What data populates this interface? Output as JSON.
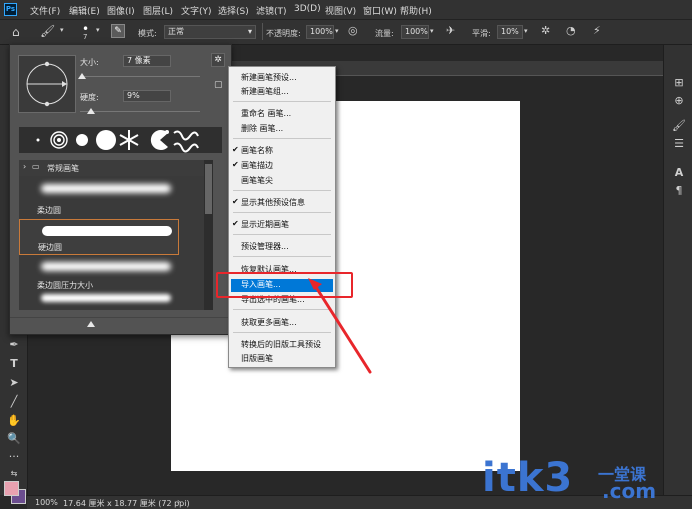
{
  "menubar": {
    "logo": "Ps",
    "items": [
      "文件(F)",
      "编辑(E)",
      "图像(I)",
      "图层(L)",
      "文字(Y)",
      "选择(S)",
      "滤镜(T)",
      "3D(D)",
      "视图(V)",
      "窗口(W)",
      "帮助(H)"
    ]
  },
  "options": {
    "size_small": "7",
    "mode_label": "模式:",
    "mode_value": "正常",
    "opacity_label": "不透明度:",
    "opacity_value": "100%",
    "flow_label": "流量:",
    "flow_value": "100%",
    "smooth_label": "平滑:",
    "smooth_value": "10%"
  },
  "brush_panel": {
    "size_label": "大小:",
    "size_value": "7 像素",
    "hardness_label": "硬度:",
    "hardness_value": "9%",
    "size_fraction": 0.02,
    "hardness_fraction": 0.09,
    "group_name": "常规画笔",
    "brushes": [
      "柔边圆",
      "硬边圆",
      "柔边圆压力大小"
    ]
  },
  "context_menu": {
    "items": [
      {
        "label": "新建画笔预设...",
        "checked": false
      },
      {
        "label": "新建画笔组...",
        "checked": false
      },
      {
        "label": "重命名 画笔...",
        "checked": false
      },
      {
        "label": "删除 画笔...",
        "checked": false
      },
      {
        "label": "画笔名称",
        "checked": true
      },
      {
        "label": "画笔描边",
        "checked": true
      },
      {
        "label": "画笔笔尖",
        "checked": false
      },
      {
        "label": "显示其他预设信息",
        "checked": true
      },
      {
        "label": "显示近期画笔",
        "checked": true
      },
      {
        "label": "预设管理器...",
        "checked": false
      },
      {
        "label": "恢复默认画笔...",
        "checked": false
      },
      {
        "label": "导入画笔...",
        "checked": false
      },
      {
        "label": "导出选中的画笔...",
        "checked": false
      },
      {
        "label": "获取更多画笔...",
        "checked": false
      },
      {
        "label": "转换后的旧版工具预设",
        "checked": false
      },
      {
        "label": "旧版画笔",
        "checked": false
      }
    ],
    "highlighted": "导入画笔..."
  },
  "status": {
    "zoom": "100%",
    "doc_info": "17.64 厘米 x 18.77 厘米 (72 ppi)"
  },
  "watermark": {
    "brand": "itk3",
    "sub": "一堂课",
    "domain": ".com"
  },
  "colors": {
    "highlight": "#0078d7",
    "annotation": "#e8262b",
    "foreground": "#e8a1b0",
    "background": "#6b4d8f"
  }
}
